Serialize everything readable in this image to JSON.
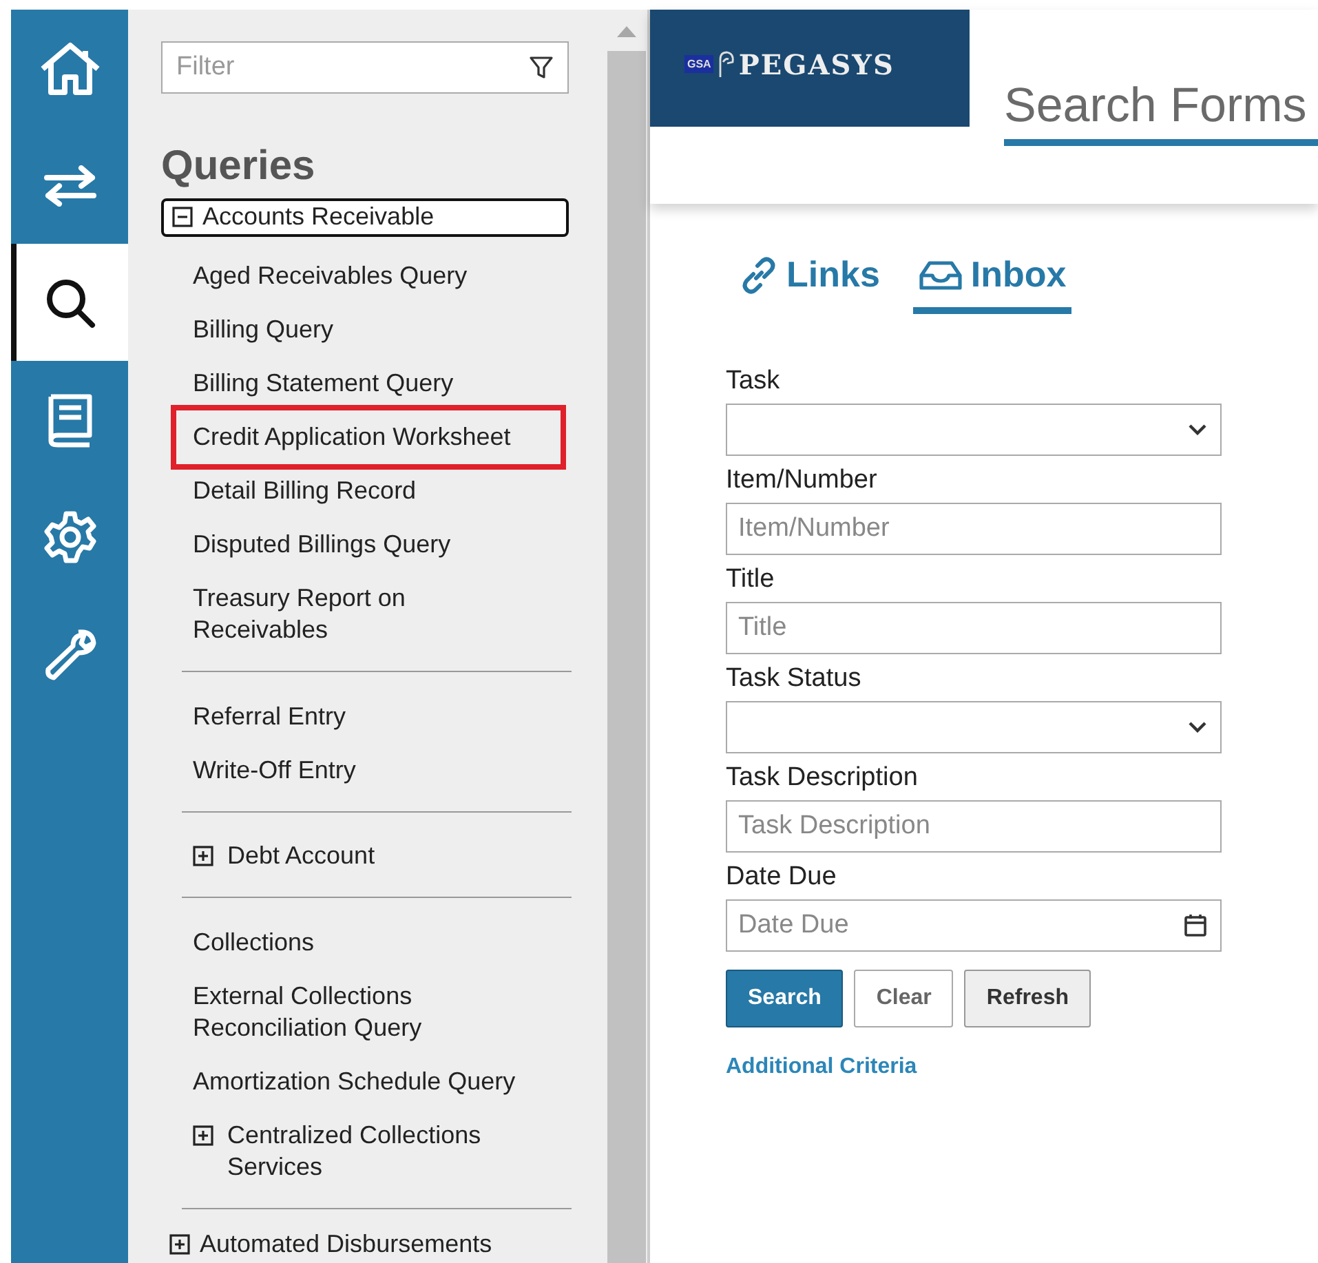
{
  "rail": [
    {
      "kind": "home",
      "selected": false
    },
    {
      "kind": "transfer",
      "selected": false
    },
    {
      "kind": "search",
      "selected": true
    },
    {
      "kind": "book",
      "selected": false
    },
    {
      "kind": "settings",
      "selected": false
    },
    {
      "kind": "wrench",
      "selected": false
    }
  ],
  "sidebar": {
    "filter": {
      "placeholder": "Filter"
    },
    "heading": "Queries",
    "tree": [
      {
        "label": "Accounts Receivable",
        "expanded": true,
        "focused": true,
        "sections": [
          {
            "children": [
              {
                "label": "Aged Receivables Query",
                "kind": "query",
                "highlighted": false
              },
              {
                "label": "Billing Query",
                "kind": "query",
                "highlighted": false
              },
              {
                "label": "Billing Statement Query",
                "kind": "query",
                "highlighted": false
              },
              {
                "label": "Credit Application Worksheet",
                "kind": "query",
                "highlighted": true
              },
              {
                "label": "Detail Billing Record",
                "kind": "query",
                "highlighted": false
              },
              {
                "label": "Disputed Billings Query",
                "kind": "query",
                "highlighted": false
              },
              {
                "label": "Treasury Report on Receivables",
                "kind": "query",
                "highlighted": false
              }
            ]
          },
          {
            "children": [
              {
                "label": "Referral Entry",
                "kind": "query",
                "highlighted": false
              },
              {
                "label": "Write-Off Entry",
                "kind": "query",
                "highlighted": false
              }
            ]
          },
          {
            "children": [
              {
                "label": "Debt Account",
                "kind": "folder",
                "expanded": false,
                "highlighted": false
              }
            ]
          },
          {
            "children": [
              {
                "label": "Collections",
                "kind": "query",
                "highlighted": false
              },
              {
                "label": "External Collections Reconciliation Query",
                "kind": "query",
                "highlighted": false
              },
              {
                "label": "Amortization Schedule Query",
                "kind": "query",
                "highlighted": false
              },
              {
                "label": "Centralized Collections Services",
                "kind": "folder",
                "expanded": false,
                "highlighted": false
              }
            ]
          }
        ]
      },
      {
        "label": "Automated Disbursements",
        "expanded": false,
        "focused": false
      }
    ]
  },
  "header": {
    "logo_badge": "GSA",
    "logo_text": "PEGASYS",
    "title": "Search Forms"
  },
  "tabs": [
    {
      "label": "Links",
      "kind": "link",
      "selected": false
    },
    {
      "label": "Inbox",
      "kind": "inbox",
      "selected": true
    }
  ],
  "form": {
    "fields": [
      {
        "label": "Task",
        "kind": "select"
      },
      {
        "label": "Item/Number",
        "kind": "text",
        "placeholder": "Item/Number"
      },
      {
        "label": "Title",
        "kind": "text",
        "placeholder": "Title"
      },
      {
        "label": "Task Status",
        "kind": "select"
      },
      {
        "label": "Task Description",
        "kind": "text",
        "placeholder": "Task Description"
      },
      {
        "label": "Date Due",
        "kind": "date",
        "placeholder": "Date Due"
      }
    ],
    "buttons": [
      {
        "label": "Search",
        "kind": "primary"
      },
      {
        "label": "Clear",
        "kind": "plain"
      },
      {
        "label": "Refresh",
        "kind": "grey"
      }
    ],
    "link": "Additional Criteria"
  }
}
